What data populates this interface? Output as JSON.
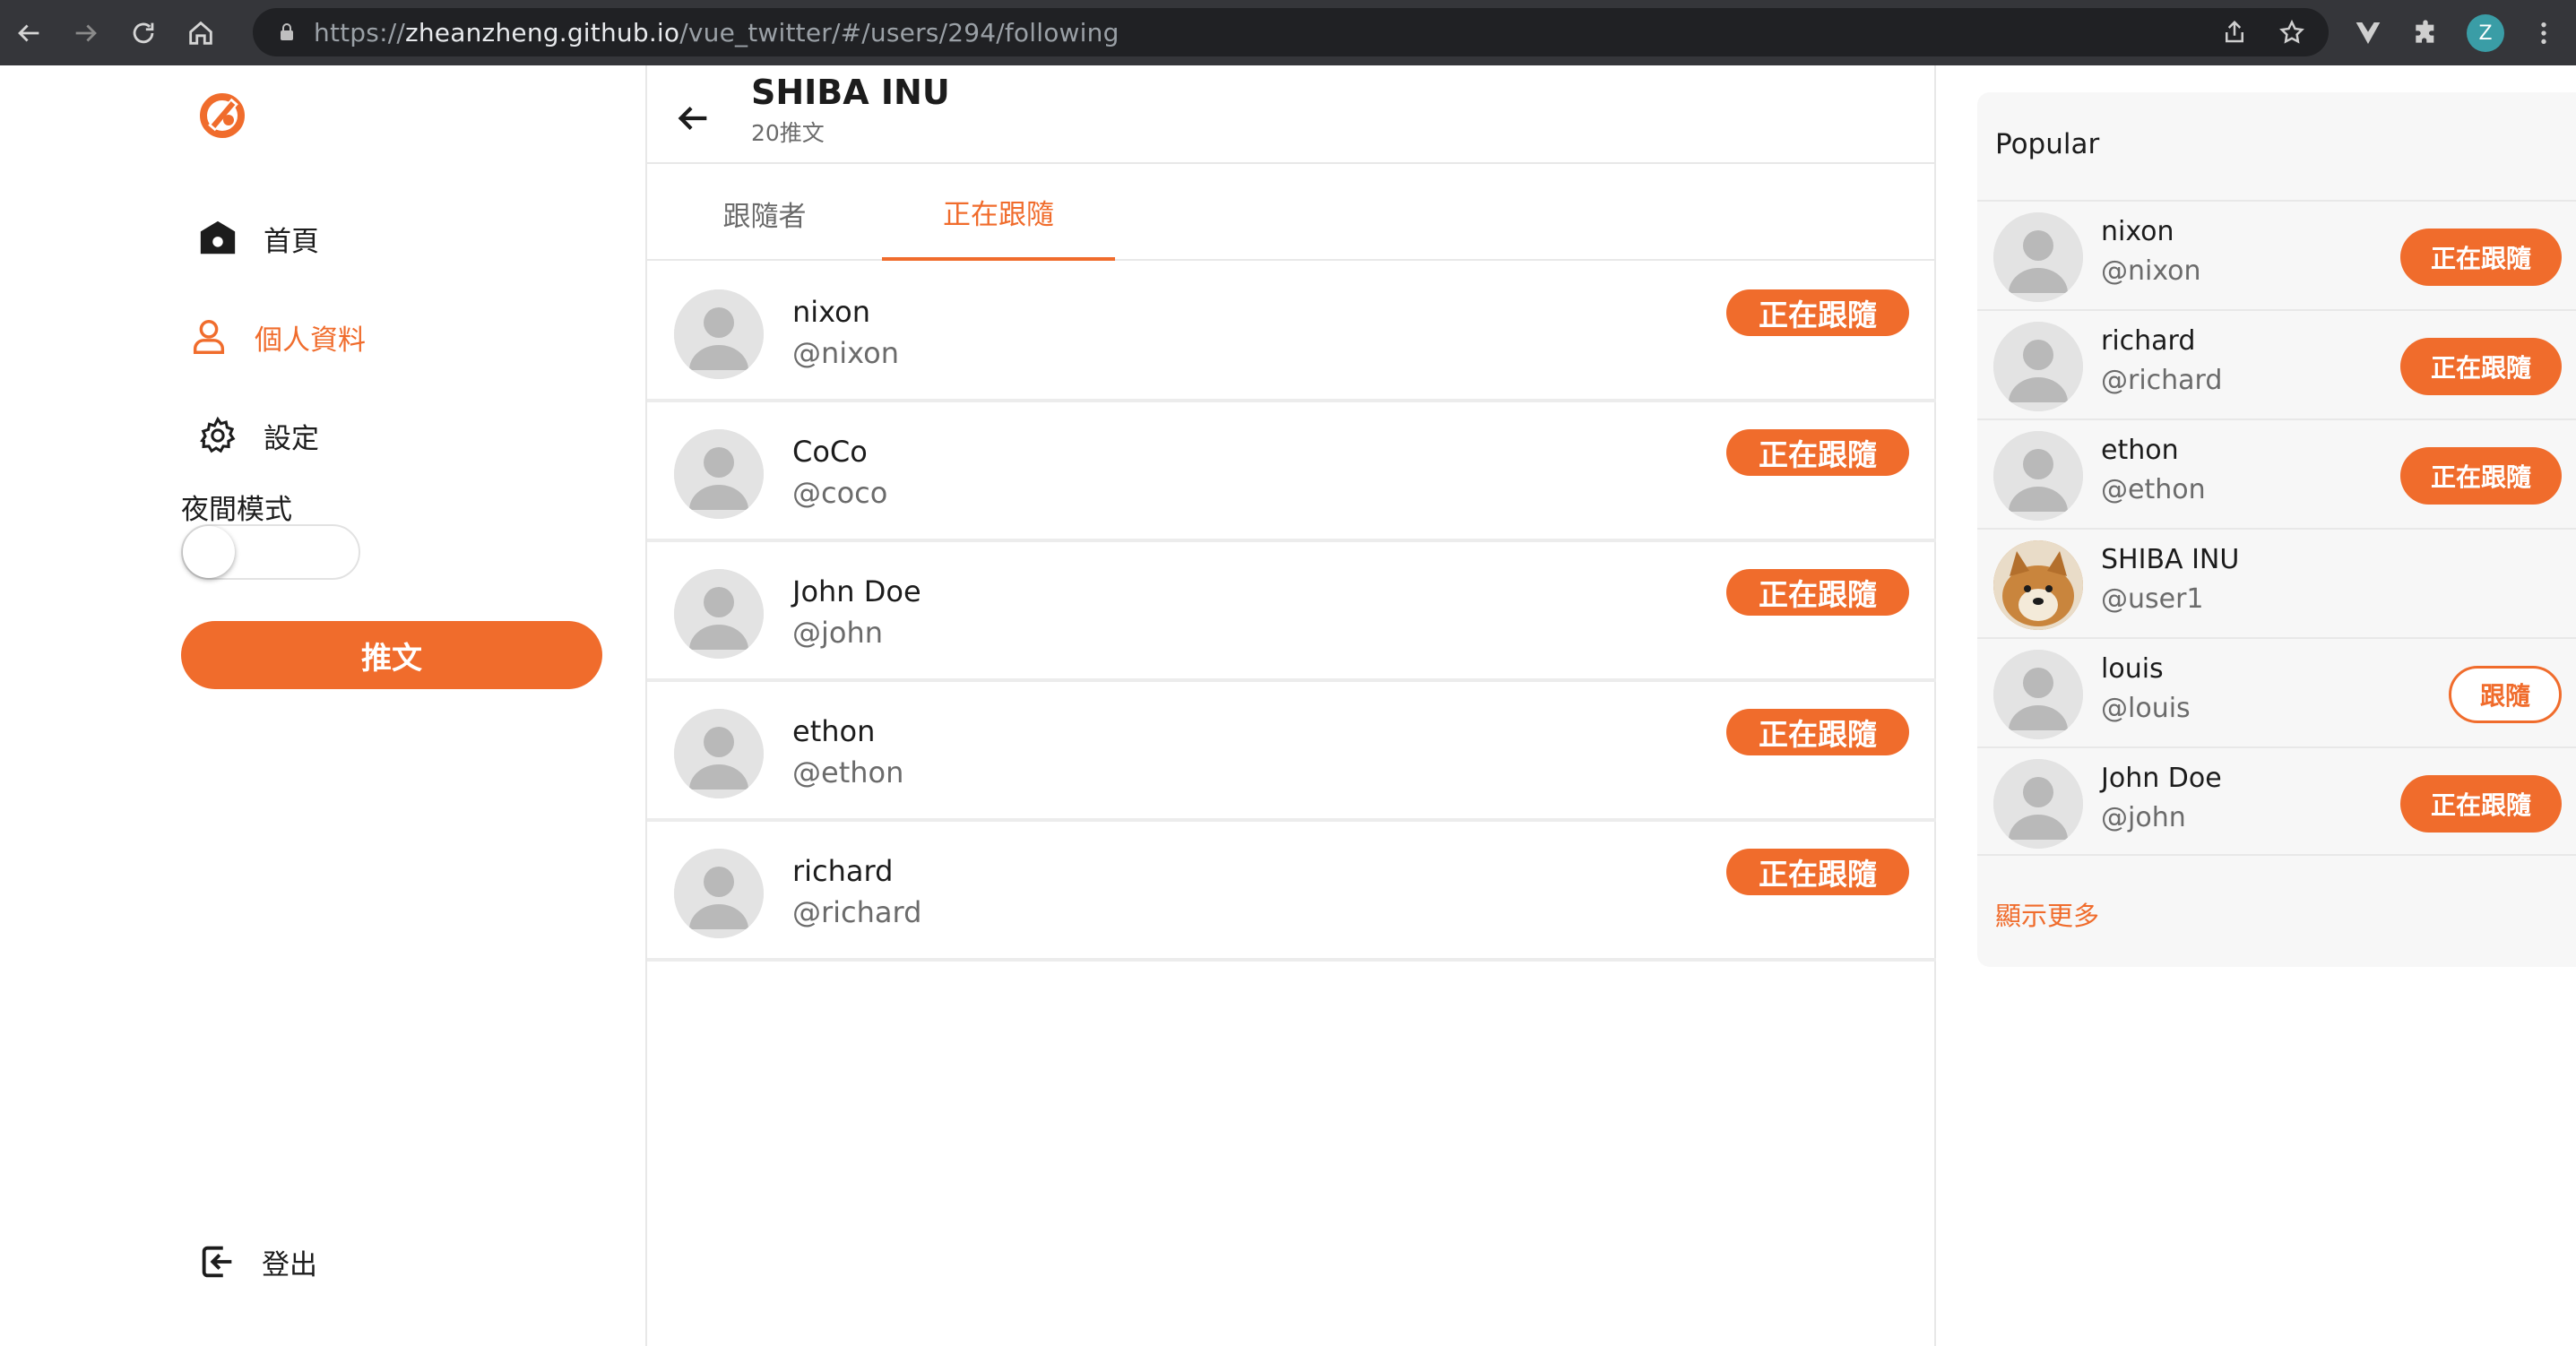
{
  "browser": {
    "url_prefix": "https://",
    "url_host": "zheanzheng.github.io",
    "url_path": "/vue_twitter/#/users/294/following",
    "profile_initial": "Z"
  },
  "sidebar": {
    "nav": [
      {
        "label": "首頁",
        "icon": "home-icon"
      },
      {
        "label": "個人資料",
        "icon": "user-icon"
      },
      {
        "label": "設定",
        "icon": "gear-icon"
      }
    ],
    "night_mode_label": "夜間模式",
    "night_mode_on": false,
    "tweet_button": "推文",
    "logout_label": "登出"
  },
  "profile": {
    "name": "SHIBA INU",
    "tweet_count": "20推文"
  },
  "tabs": [
    {
      "label": "跟隨者",
      "active": false
    },
    {
      "label": "正在跟隨",
      "active": true
    }
  ],
  "following": [
    {
      "name": "nixon",
      "handle": "@nixon",
      "button": "正在跟隨"
    },
    {
      "name": "CoCo",
      "handle": "@coco",
      "button": "正在跟隨"
    },
    {
      "name": "John Doe",
      "handle": "@john",
      "button": "正在跟隨"
    },
    {
      "name": "ethon",
      "handle": "@ethon",
      "button": "正在跟隨"
    },
    {
      "name": "richard",
      "handle": "@richard",
      "button": "正在跟隨"
    }
  ],
  "popular": {
    "title": "Popular",
    "users": [
      {
        "name": "nixon",
        "handle": "@nixon",
        "button": "正在跟隨"
      },
      {
        "name": "richard",
        "handle": "@richard",
        "button": "正在跟隨"
      },
      {
        "name": "ethon",
        "handle": "@ethon",
        "button": "正在跟隨"
      },
      {
        "name": "SHIBA INU",
        "handle": "@user1",
        "button": ""
      },
      {
        "name": "louis",
        "handle": "@louis",
        "button": "跟隨"
      },
      {
        "name": "John Doe",
        "handle": "@john",
        "button": "正在跟隨"
      }
    ],
    "show_more": "顯示更多"
  },
  "colors": {
    "accent": "#f06c2c",
    "text": "#1c1c1c",
    "muted": "#6b6b6b"
  }
}
